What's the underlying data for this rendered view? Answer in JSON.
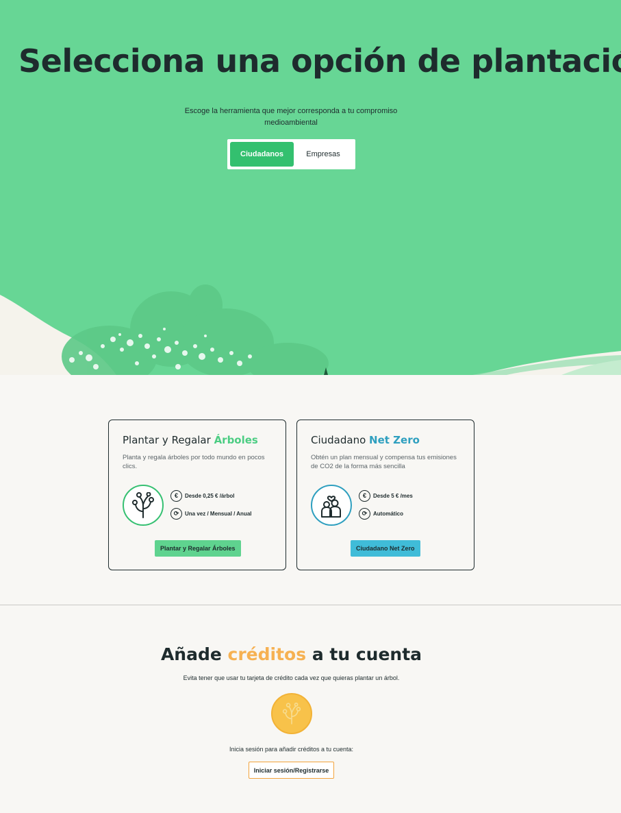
{
  "hero": {
    "title": "Selecciona una opción de plantación",
    "subtitle": "Escoge la herramienta que mejor corresponda a tu compromiso medioambiental",
    "tabs": [
      {
        "label": "Ciudadanos",
        "active": true
      },
      {
        "label": "Empresas",
        "active": false
      }
    ]
  },
  "cards": [
    {
      "title_prefix": "Plantar y Regalar ",
      "title_highlight": "Árboles",
      "description": "Planta y regala árboles por todo mundo en pocos clics.",
      "icon": "tree-icon",
      "features": [
        {
          "icon": "euro-icon",
          "text": "Desde 0,25 € /árbol"
        },
        {
          "icon": "refresh-icon",
          "text": "Una vez / Mensual / Anual"
        }
      ],
      "button": "Plantar y Regalar Árboles",
      "accent": "#4ccd83"
    },
    {
      "title_prefix": "Ciudadano ",
      "title_highlight": "Net Zero",
      "description": "Obtén un plan mensual y compensa tus emisiones de CO2 de la forma más sencilla",
      "icon": "people-heart-icon",
      "features": [
        {
          "icon": "euro-icon",
          "text": "Desde 5 € /mes"
        },
        {
          "icon": "refresh-icon",
          "text": "Automático"
        }
      ],
      "button": "Ciudadano Net Zero",
      "accent": "#2e9fbf"
    }
  ],
  "credits": {
    "title_before": "Añade ",
    "title_accent": "créditos",
    "title_after": " a tu cuenta",
    "subtitle": "Evita tener que usar tu tarjeta de crédito cada vez que quieras plantar un árbol.",
    "coin_icon": "tree-coin-icon",
    "login_text": "Inicia sesión para añadir créditos a tu cuenta:",
    "login_button": "Iniciar sesión/Registrarse",
    "accent": "#f6b152"
  },
  "colors": {
    "hero_bg": "#67d695",
    "primary_green": "#33c06f",
    "net_zero_blue": "#40bcd8",
    "page_bg": "#f8f7f4"
  }
}
